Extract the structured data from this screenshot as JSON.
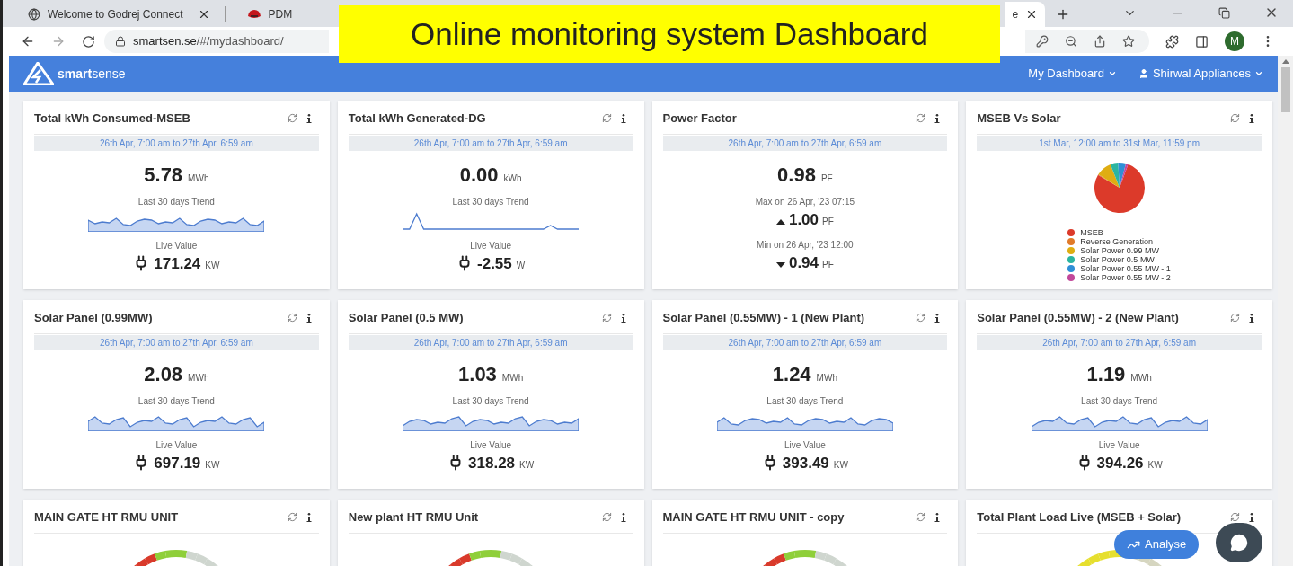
{
  "overlay_title": "Online monitoring system Dashboard",
  "browser": {
    "tabs": [
      {
        "title": "Welcome to Godrej Connect",
        "selected": false
      },
      {
        "title": "PDM",
        "selected": false
      },
      {
        "title": "e",
        "selected": true
      }
    ],
    "url": {
      "host": "smartsen.se",
      "path": "/#/mydashboard/"
    },
    "profile": "M"
  },
  "app": {
    "logo": "**smart**sense",
    "nav": [
      {
        "label": "My Dashboard"
      },
      {
        "label": "Shirwal Appliances"
      }
    ]
  },
  "cards": [
    {
      "kind": "metric",
      "title": "Total kWh Consumed-MSEB",
      "range": "26th Apr, 7:00 am  to 27th Apr, 6:59 am",
      "value": "5.78",
      "unit": "MWh",
      "trend_label": "Last 30 days Trend",
      "live_label": "Live Value",
      "live": "171.24",
      "live_unit": "KW"
    },
    {
      "kind": "metric",
      "title": "Total kWh Generated-DG",
      "range": "26th Apr, 7:00 am  to 27th Apr, 6:59 am",
      "value": "0.00",
      "unit": "kWh",
      "trend_label": "Last 30 days Trend",
      "live_label": "Live Value",
      "live": "-2.55",
      "live_unit": "W"
    },
    {
      "kind": "pf",
      "title": "Power Factor",
      "range": "26th Apr, 7:00 am  to 27th Apr, 6:59 am",
      "value": "0.98",
      "unit": "PF",
      "max_label": "Max on 26 Apr, '23 07:15",
      "max": "1.00",
      "max_unit": "PF",
      "min_label": "Min on 26 Apr, '23 12:00",
      "min": "0.94",
      "min_unit": "PF"
    },
    {
      "kind": "pie",
      "title": "MSEB Vs Solar",
      "range": "1st Mar, 12:00 am  to 31st Mar, 11:59 pm",
      "legend": [
        {
          "label": "MSEB",
          "color": "#dc3a2a"
        },
        {
          "label": "Reverse Generation",
          "color": "#e07a2a"
        },
        {
          "label": "Solar Power 0.99 MW",
          "color": "#dfad12"
        },
        {
          "label": "Solar Power 0.5 MW",
          "color": "#2bb5a0"
        },
        {
          "label": "Solar Power 0.55 MW - 1",
          "color": "#2f8fd6"
        },
        {
          "label": "Solar Power 0.55 MW - 2",
          "color": "#c2489a"
        }
      ]
    },
    {
      "kind": "metric",
      "title": "Solar Panel (0.99MW)",
      "range": "26th Apr, 7:00 am  to 27th Apr, 6:59 am",
      "value": "2.08",
      "unit": "MWh",
      "trend_label": "Last 30 days Trend",
      "live_label": "Live Value",
      "live": "697.19",
      "live_unit": "KW"
    },
    {
      "kind": "metric",
      "title": "Solar Panel (0.5 MW)",
      "range": "26th Apr, 7:00 am  to 27th Apr, 6:59 am",
      "value": "1.03",
      "unit": "MWh",
      "trend_label": "Last 30 days Trend",
      "live_label": "Live Value",
      "live": "318.28",
      "live_unit": "KW"
    },
    {
      "kind": "metric",
      "title": "Solar Panel (0.55MW) - 1 (New Plant)",
      "range": "26th Apr, 7:00 am  to 27th Apr, 6:59 am",
      "value": "1.24",
      "unit": "MWh",
      "trend_label": "Last 30 days Trend",
      "live_label": "Live Value",
      "live": "393.49",
      "live_unit": "KW"
    },
    {
      "kind": "metric",
      "title": "Solar Panel (0.55MW) - 2 (New Plant)",
      "range": "26th Apr, 7:00 am  to 27th Apr, 6:59 am",
      "value": "1.19",
      "unit": "MWh",
      "trend_label": "Last 30 days Trend",
      "live_label": "Live Value",
      "live": "394.26",
      "live_unit": "KW"
    },
    {
      "kind": "gauge",
      "title": "MAIN GATE HT RMU UNIT"
    },
    {
      "kind": "gauge",
      "title": "New plant HT RMU Unit"
    },
    {
      "kind": "gauge",
      "title": "MAIN GATE HT RMU UNIT - copy"
    },
    {
      "kind": "gauge",
      "title": "Total Plant Load Live (MSEB + Solar)"
    }
  ],
  "analyse_button": "Analyse"
}
